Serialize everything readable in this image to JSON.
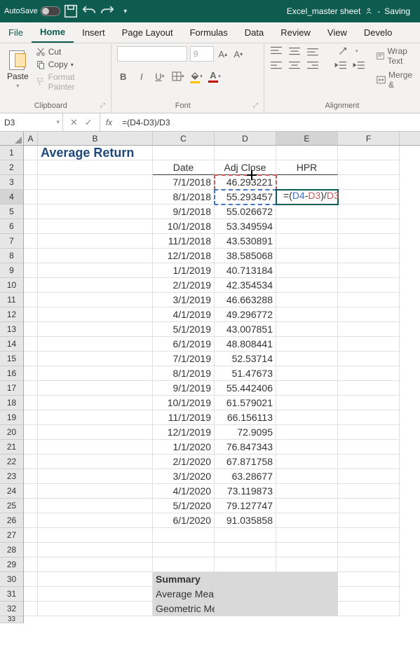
{
  "titlebar": {
    "autosave": "AutoSave",
    "doc": "Excel_master sheet",
    "status": "Saving"
  },
  "menu": [
    "File",
    "Home",
    "Insert",
    "Page Layout",
    "Formulas",
    "Data",
    "Review",
    "View",
    "Develo"
  ],
  "ribbon": {
    "clipboard": {
      "label": "Clipboard",
      "paste": "Paste",
      "cut": "Cut",
      "copy": "Copy",
      "fmt": "Format Painter"
    },
    "font": {
      "label": "Font",
      "size": "9"
    },
    "alignment": {
      "label": "Alignment",
      "wrap": "Wrap Text",
      "merge": "Merge &"
    }
  },
  "namebox": "D3",
  "formula": "=(D4-D3)/D3",
  "cols": [
    "A",
    "B",
    "C",
    "D",
    "E",
    "F"
  ],
  "title": "Average Return",
  "headers": {
    "date": "Date",
    "adj": "Adj Close",
    "hpr": "HPR"
  },
  "chart_data": {
    "type": "table",
    "columns": [
      "Date",
      "Adj Close"
    ],
    "rows": [
      [
        "7/1/2018",
        46.293221
      ],
      [
        "8/1/2018",
        55.293457
      ],
      [
        "9/1/2018",
        55.026672
      ],
      [
        "10/1/2018",
        53.349594
      ],
      [
        "11/1/2018",
        43.530891
      ],
      [
        "12/1/2018",
        38.585068
      ],
      [
        "1/1/2019",
        40.713184
      ],
      [
        "2/1/2019",
        42.354534
      ],
      [
        "3/1/2019",
        46.663288
      ],
      [
        "4/1/2019",
        49.296772
      ],
      [
        "5/1/2019",
        43.007851
      ],
      [
        "6/1/2019",
        48.808441
      ],
      [
        "7/1/2019",
        52.53714
      ],
      [
        "8/1/2019",
        51.47673
      ],
      [
        "9/1/2019",
        55.442406
      ],
      [
        "10/1/2019",
        61.579021
      ],
      [
        "11/1/2019",
        66.156113
      ],
      [
        "12/1/2019",
        72.9095
      ],
      [
        "1/1/2020",
        76.847343
      ],
      [
        "2/1/2020",
        67.871758
      ],
      [
        "3/1/2020",
        63.28677
      ],
      [
        "4/1/2020",
        73.119873
      ],
      [
        "5/1/2020",
        79.127747
      ],
      [
        "6/1/2020",
        91.035858
      ]
    ]
  },
  "editing": {
    "text": "=(",
    "ref1": "D4",
    "mid": "-",
    "ref2": "D3",
    "mid2": ")/",
    "ref3": "D3"
  },
  "summary": {
    "title": "Summary",
    "avg": "Average Mean Return",
    "geo": "Geometric Mean Return"
  }
}
